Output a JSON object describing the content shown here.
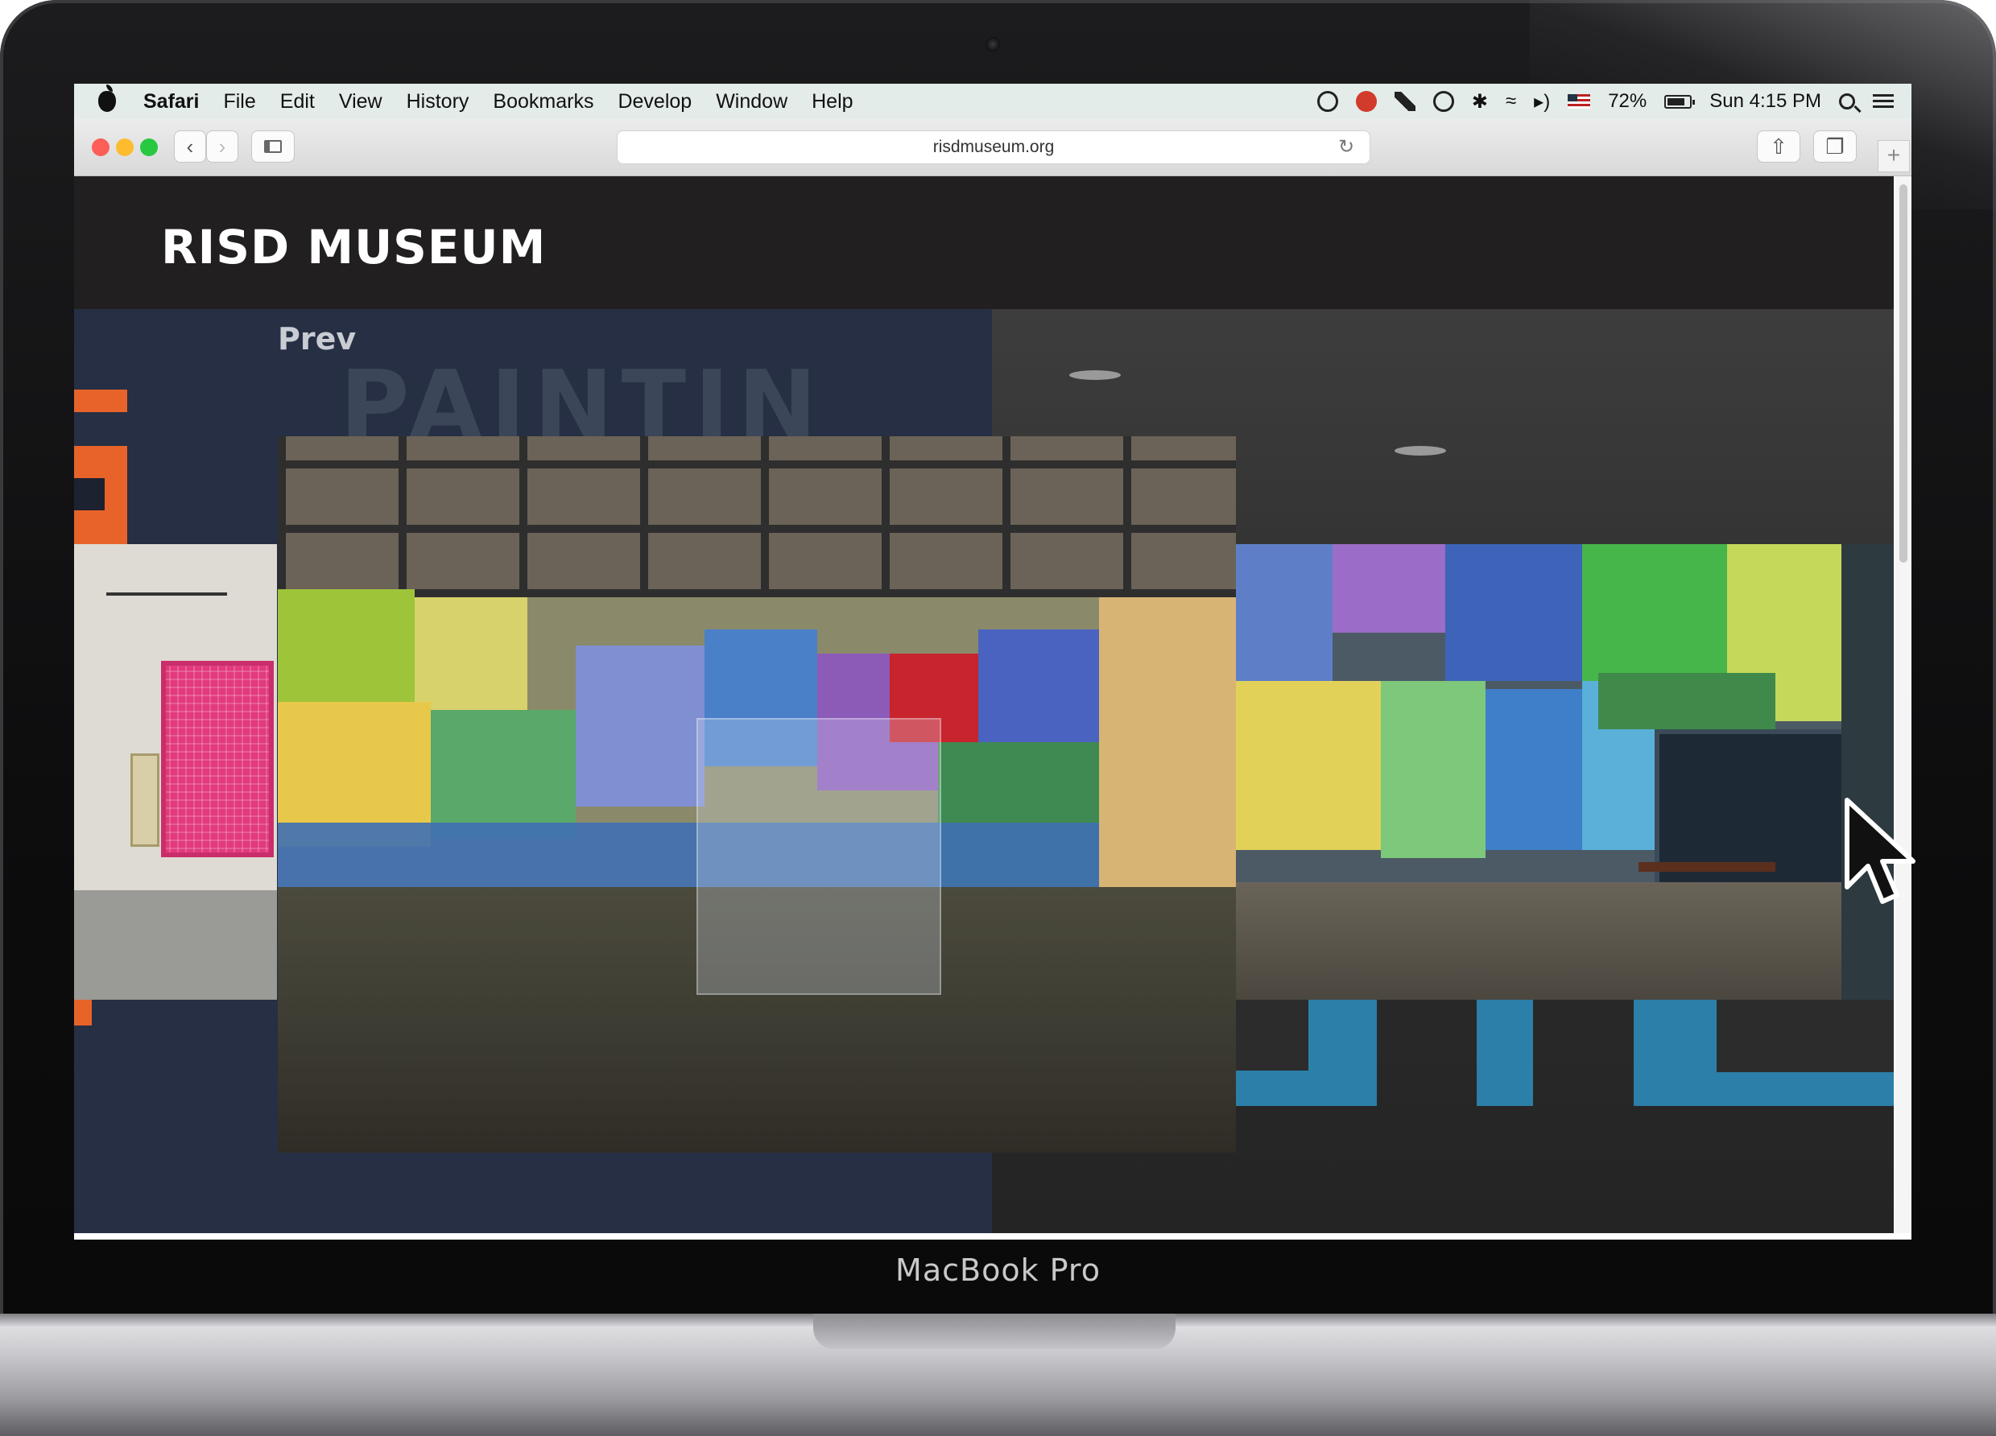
{
  "device": {
    "label": "MacBook Pro"
  },
  "menubar": {
    "app_name": "Safari",
    "items": [
      "File",
      "Edit",
      "View",
      "History",
      "Bookmarks",
      "Develop",
      "Window",
      "Help"
    ],
    "battery": "72%",
    "clock": "Sun 4:15 PM"
  },
  "browser": {
    "url": "risdmuseum.org",
    "back_icon": "chevron-left-icon",
    "forward_icon": "chevron-right-icon",
    "new_tab_label": "+"
  },
  "site": {
    "logo": "RISD MUSEUM",
    "prev_label": "Prev",
    "background_word": "PAINTIN"
  },
  "colors": {
    "accent_orange": "#e8632a",
    "accent_blue": "#2b7fa8",
    "header_bg": "#221f20"
  }
}
